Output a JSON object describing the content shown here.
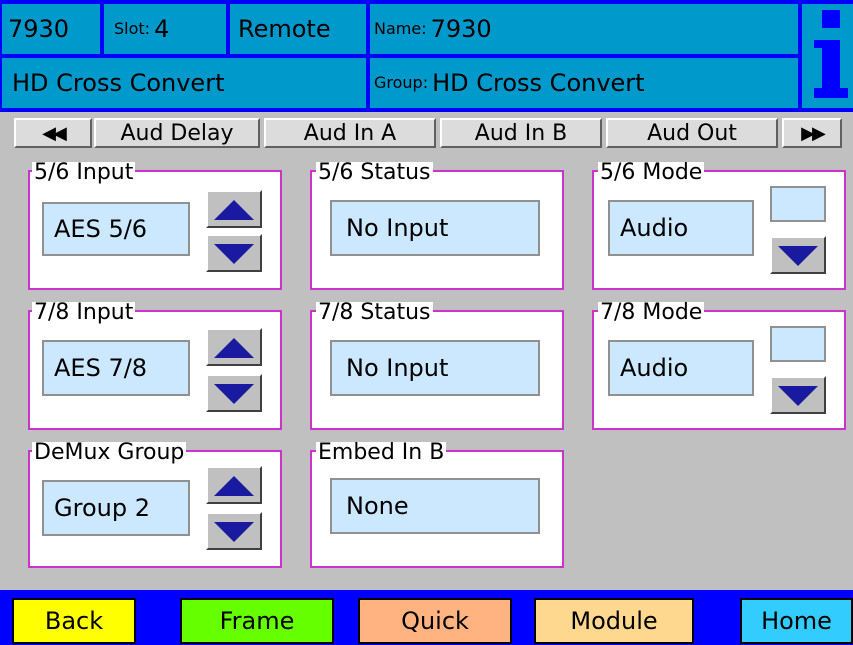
{
  "header": {
    "model": "7930",
    "slot_label": "Slot:",
    "slot_value": "4",
    "mode": "Remote",
    "name_label": "Name:",
    "name_value": "7930",
    "card_type": "HD Cross Convert",
    "group_label": "Group:",
    "group_value": "HD Cross Convert",
    "info_icon": "info-icon"
  },
  "tabs": {
    "prev_glyph": "◀◀",
    "next_glyph": "▶▶",
    "items": [
      "Aud Delay",
      "Aud In A",
      "Aud In B",
      "Aud Out"
    ]
  },
  "panels": {
    "input56": {
      "label": "5/6 Input",
      "value": "AES  5/6"
    },
    "status56": {
      "label": "5/6 Status",
      "value": "No Input"
    },
    "mode56": {
      "label": "5/6 Mode",
      "value": "Audio"
    },
    "input78": {
      "label": "7/8 Input",
      "value": "AES  7/8"
    },
    "status78": {
      "label": "7/8 Status",
      "value": "No Input"
    },
    "mode78": {
      "label": "7/8 Mode",
      "value": "Audio"
    },
    "demux": {
      "label": "DeMux Group",
      "value": "Group 2"
    },
    "embed": {
      "label": "Embed In B",
      "value": "None"
    }
  },
  "footer": {
    "back": "Back",
    "frame": "Frame",
    "quick": "Quick",
    "module": "Module",
    "home": "Home"
  },
  "colors": {
    "header_blue": "#0099cc",
    "frame_blue": "#0000ff",
    "panel_border": "#cc33cc",
    "value_bg": "#cce8ff",
    "back": "#ffff00",
    "frame": "#66ff00",
    "quick": "#ffb380",
    "module": "#ffd890",
    "home": "#33ccff"
  }
}
